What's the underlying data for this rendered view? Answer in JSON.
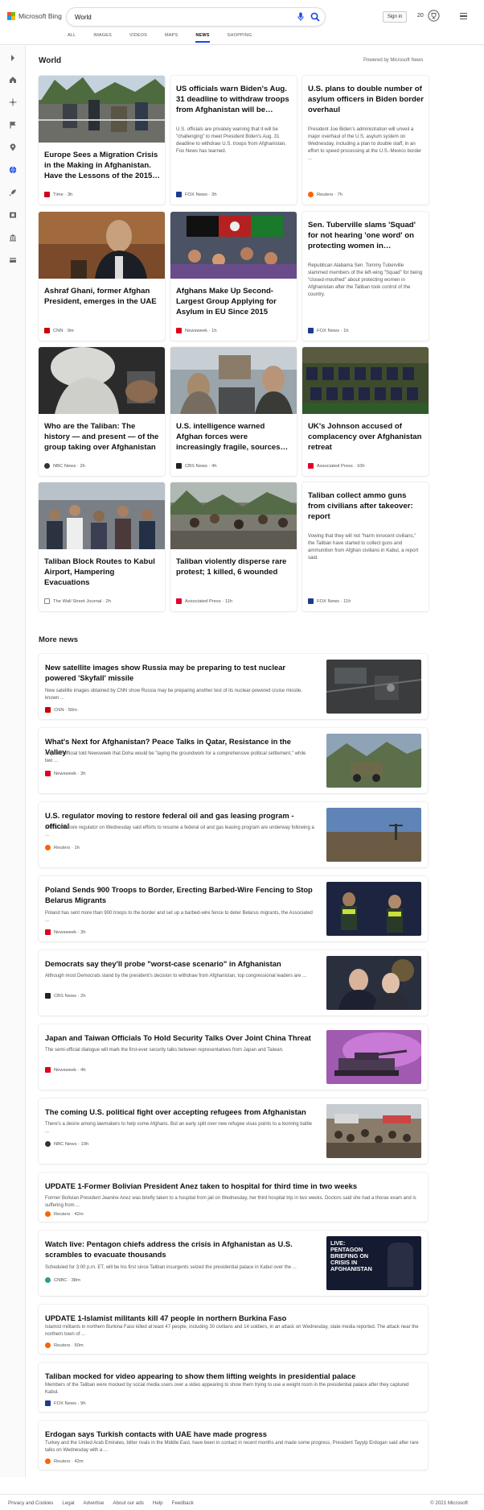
{
  "header": {
    "logo_text": "Microsoft Bing",
    "search_value": "World",
    "signin_label": "Sign in",
    "rewards_count": "20",
    "tabs": [
      {
        "label": "ALL"
      },
      {
        "label": "IMAGES"
      },
      {
        "label": "VIDEOS"
      },
      {
        "label": "MAPS"
      },
      {
        "label": "NEWS"
      },
      {
        "label": "SHOPPING"
      }
    ],
    "active_tab": "NEWS"
  },
  "colors": {
    "accent": "#174ae4",
    "ms_red": "#f25022",
    "ms_green": "#7fba00",
    "ms_blue": "#00a4ef",
    "ms_yellow": "#ffb900"
  },
  "sidebar": {
    "icons": [
      "chevron-right-icon",
      "home-icon",
      "star-icon",
      "flag-icon",
      "location-icon",
      "globe-icon",
      "rocket-icon",
      "film-icon",
      "bank-icon",
      "card-icon"
    ]
  },
  "main": {
    "title": "World",
    "powered_by": "Powered by Microsoft News",
    "cards": [
      {
        "title": "Europe Sees a Migration Crisis in the Making in Afghanistan. Have the Lessons of the 2015…",
        "source": "Time · 3h",
        "favicon": "#d0021b"
      },
      {
        "title": "US officials warn Biden's Aug. 31 deadline to withdraw troops from Afghanistan will be…",
        "desc": "U.S. officials are privately warning that it will be \"challenging\" to meet President Biden's Aug. 31 deadline to withdraw U.S. troops from Afghanistan, Fox News has learned.",
        "source": "FOX News · 3h",
        "favicon": "#1d3b8f"
      },
      {
        "title": "U.S. plans to double number of asylum officers in Biden border overhaul",
        "desc": "President Joe Biden's administration will unveil a major overhaul of the U.S. asylum system on Wednesday, including a plan to double staff, in an effort to speed processing at the U.S.-Mexico border ...",
        "source": "Reuters · 7h",
        "favicon": "#fa6400"
      },
      {
        "title": "Ashraf Ghani, former Afghan President, emerges in the UAE",
        "source": "CNN · 9m",
        "favicon": "#cc0000"
      },
      {
        "title": "Afghans Make Up Second-Largest Group Applying for Asylum in EU Since 2015",
        "source": "Newsweek · 1h",
        "favicon": "#e0001b"
      },
      {
        "title": "Sen. Tuberville slams 'Squad' for not hearing 'one word' on protecting women in…",
        "desc": "Republican Alabama Sen. Tommy Tuberville slammed members of the left-wing \"Squad\" for being \"closed-mouthed\" about protecting women in Afghanistan after the Taliban took control of the country.",
        "source": "FOX News · 1h",
        "favicon": "#1d3b8f"
      },
      {
        "title": "Who are the Taliban: The history — and present — of the group taking over Afghanistan",
        "source": "NBC News · 2h",
        "favicon": "#333333"
      },
      {
        "title": "U.S. intelligence warned Afghan forces were increasingly fragile, sources…",
        "source": "CBS News · 4h",
        "favicon": "#222222"
      },
      {
        "title": "UK's Johnson accused of complacency over Afghanistan retreat",
        "source": "Associated Press · 10h",
        "favicon": "#e4002b"
      },
      {
        "title": "Taliban Block Routes to Kabul Airport, Hampering Evacuations",
        "source": "The Wall Street Journal · 2h",
        "favicon": "#888888"
      },
      {
        "title": "Taliban violently disperse rare protest; 1 killed, 6 wounded",
        "source": "Associated Press · 11h",
        "favicon": "#e4002b"
      },
      {
        "title": "Taliban collect ammo guns from civilians after takeover: report",
        "desc": "Vowing that they will not \"harm innocent civilians,\" the Taliban have started to collect guns and ammunition from Afghan civilians in Kabul, a report said.",
        "source": "FOX News · 11h",
        "favicon": "#1d3b8f"
      }
    ]
  },
  "more_news": {
    "title": "More news",
    "items": [
      {
        "title": "New satellite images show Russia may be preparing to test nuclear powered 'Skyfall' missile",
        "desc": "New satellite images obtained by CNN show Russia may be preparing another test of its nuclear-powered cruise missile, known ...",
        "source": "CNN · 50m",
        "favicon": "#cc0000"
      },
      {
        "title": "What's Next for Afghanistan? Peace Talks in Qatar, Resistance in the Valley",
        "desc": "A Qatari official told Newsweek that Doha would be \"laying the groundwork for a comprehensive political settlement,\" while two ...",
        "source": "Newsweek · 3h",
        "favicon": "#e0001b"
      },
      {
        "title": "U.S. regulator moving to restore federal oil and gas leasing program - official",
        "desc": "A U.S. offshore regulator on Wednesday said efforts to resume a federal oil and gas leasing program are underway following a ...",
        "source": "Reuters · 1h",
        "favicon": "#fa6400"
      },
      {
        "title": "Poland Sends 900 Troops to Border, Erecting Barbed-Wire Fencing to Stop Belarus Migrants",
        "desc": "Poland has sent more than 900 troops to the border and set up a barbed-wire fence to deter Belarus migrants, the Associated ...",
        "source": "Newsweek · 3h",
        "favicon": "#e0001b"
      },
      {
        "title": "Democrats say they'll probe \"worst-case scenario\" in Afghanistan",
        "desc": "Although most Democrats stand by the president's decision to withdraw from Afghanistan, top congressional leaders are ...",
        "source": "CBS News · 2h",
        "favicon": "#222222"
      },
      {
        "title": "Japan and Taiwan Officials To Hold Security Talks Over Joint China Threat",
        "desc": "The semi-official dialogue will mark the first-ever security talks between representatives from Japan and Taiwan.",
        "source": "Newsweek · 4h",
        "favicon": "#e0001b"
      },
      {
        "title": "The coming U.S. political fight over accepting refugees from Afghanistan",
        "desc": "There's a desire among lawmakers to help some Afghans. But an early split over new refugee visas points to a looming battle ...",
        "source": "NBC News · 10h",
        "favicon": "#333333"
      },
      {
        "title": "UPDATE 1-Former Bolivian President Anez taken to hospital for third time in two weeks",
        "desc": "Former Bolivian President Jeanine Anez was briefly taken to a hospital from jail on Wednesday, her third hospital trip in two weeks. Doctors said she had a thorax exam and is suffering from ...",
        "source": "Reuters · 42m",
        "favicon": "#fa6400"
      },
      {
        "title": "Watch live: Pentagon chiefs address the crisis in Afghanistan as U.S. scrambles to evacuate thousands",
        "desc": "Scheduled for 3:00 p.m. ET, will be his first since Taliban insurgents seized the presidential palace in Kabul over the ...",
        "source": "CNBC · 38m",
        "favicon": "#2a9d8f",
        "thumb_text": "LIVE: PENTAGON BRIEFING ON CRISIS IN AFGHANISTAN"
      },
      {
        "title": "UPDATE 1-Islamist militants kill 47 people in northern Burkina Faso",
        "desc": "Islamist militants in northern Burkina Faso killed at least 47 people, including 30 civilians and 14 soldiers, in an attack on Wednesday, state media reported. The attack near the northern town of ...",
        "source": "Reuters · 50m",
        "favicon": "#fa6400"
      },
      {
        "title": "Taliban mocked for video appearing to show them lifting weights in presidential palace",
        "desc": "Members of the Taliban were mocked by social media users over a video appearing to show them trying to use a weight room in the presidential palace after they captured Kabul.",
        "source": "FOX News · 9h",
        "favicon": "#1d3b8f"
      },
      {
        "title": "Erdogan says Turkish contacts with UAE have made progress",
        "desc": "Turkey and the United Arab Emirates, bitter rivals in the Middle East, have been in contact in recent months and made some progress, President Tayyip Erdogan said after rare talks on Wednesday with a ...",
        "source": "Reuters · 42m",
        "favicon": "#fa6400"
      }
    ]
  },
  "footer": {
    "links": [
      "Privacy and Cookies",
      "Legal",
      "Advertise",
      "About our ads",
      "Help",
      "Feedback"
    ],
    "copyright": "© 2021 Microsoft"
  }
}
